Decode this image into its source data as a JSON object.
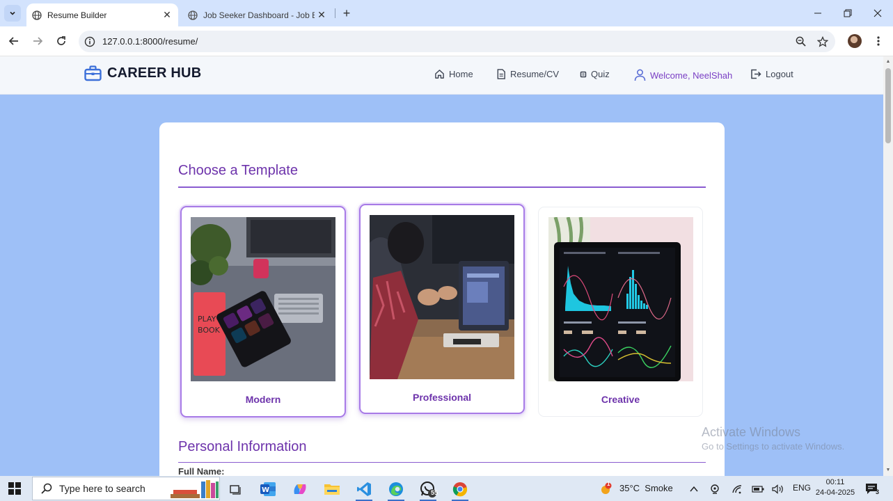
{
  "browser": {
    "tabs": [
      {
        "title": "Resume Builder",
        "active": true
      },
      {
        "title": "Job Seeker Dashboard - Job Bo",
        "active": false
      }
    ],
    "url": "127.0.0.1:8000/resume/"
  },
  "site": {
    "brand": "CAREER HUB",
    "nav": {
      "home": "Home",
      "resume": "Resume/CV",
      "quiz": "Quiz",
      "welcome": "Welcome, NeelShah",
      "logout": "Logout"
    }
  },
  "content": {
    "choose_template_title": "Choose a Template",
    "templates": [
      {
        "label": "Modern",
        "selected": true
      },
      {
        "label": "Professional",
        "selected": true
      },
      {
        "label": "Creative",
        "selected": false
      }
    ],
    "personal_info_title": "Personal Information",
    "full_name_label": "Full Name:"
  },
  "watermark": {
    "line1": "Activate Windows",
    "line2": "Go to Settings to activate Windows."
  },
  "taskbar": {
    "search_placeholder": "Type here to search",
    "whatsapp_badge": "55",
    "weather": "35°C  Smoke",
    "weather_badge": "1",
    "language": "ENG",
    "time": "00:11",
    "date": "24-04-2025",
    "notifications": "3"
  },
  "colors": {
    "accent_purple": "#6d33ab",
    "page_bg": "#9ec0f7"
  }
}
